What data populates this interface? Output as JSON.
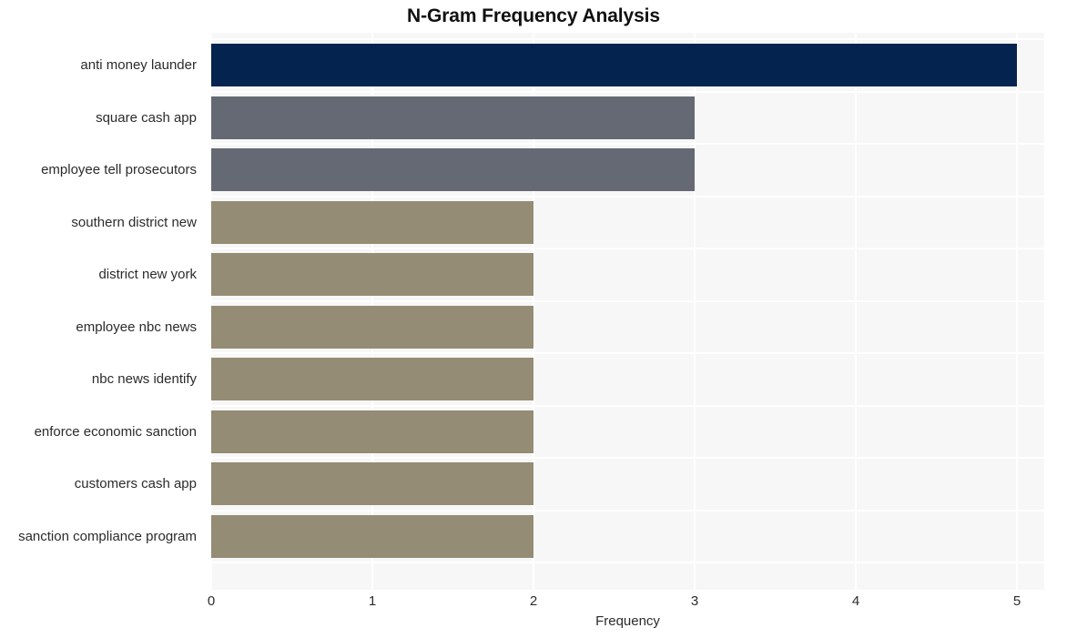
{
  "chart_data": {
    "type": "bar",
    "orientation": "horizontal",
    "title": "N-Gram Frequency Analysis",
    "xlabel": "Frequency",
    "ylabel": "",
    "xlim": [
      0,
      5
    ],
    "xticks": [
      0,
      1,
      2,
      3,
      4,
      5
    ],
    "xtick_labels": [
      "0",
      "1",
      "2",
      "3",
      "4",
      "5"
    ],
    "grid": true,
    "legend": null,
    "categories": [
      "anti money launder",
      "square cash app",
      "employee tell prosecutors",
      "southern district new",
      "district new york",
      "employee nbc news",
      "nbc news identify",
      "enforce economic sanction",
      "customers cash app",
      "sanction compliance program"
    ],
    "values": [
      5,
      3,
      3,
      2,
      2,
      2,
      2,
      2,
      2,
      2
    ],
    "bar_colors": [
      "#04234f",
      "#656973",
      "#656973",
      "#948c74",
      "#948c74",
      "#948c74",
      "#948c74",
      "#948c74",
      "#948c74",
      "#948c74"
    ]
  },
  "style": {
    "plot_background": "#f7f7f7",
    "figure_background": "#ffffff",
    "gridline_color": "#ffffff",
    "text_color": "#2b2b2b",
    "title_color": "#111111"
  }
}
